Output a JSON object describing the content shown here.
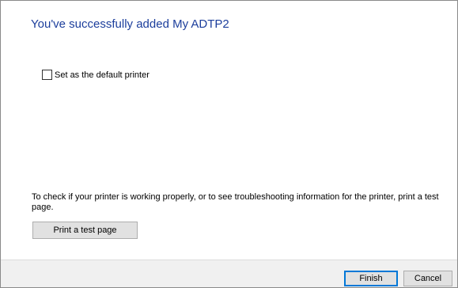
{
  "dialog": {
    "heading": "You've successfully added My ADTP2",
    "default_printer": {
      "label": "Set as the default printer",
      "checked": false
    },
    "info_text": "To check if your printer is working properly, or to see troubleshooting information for the printer, print a test page.",
    "test_page_button": "Print a test page"
  },
  "footer": {
    "finish_label": "Finish",
    "cancel_label": "Cancel"
  },
  "colors": {
    "heading": "#1c3e9c",
    "footer_bg": "#f0f0f0",
    "default_button_border": "#0078d7"
  }
}
